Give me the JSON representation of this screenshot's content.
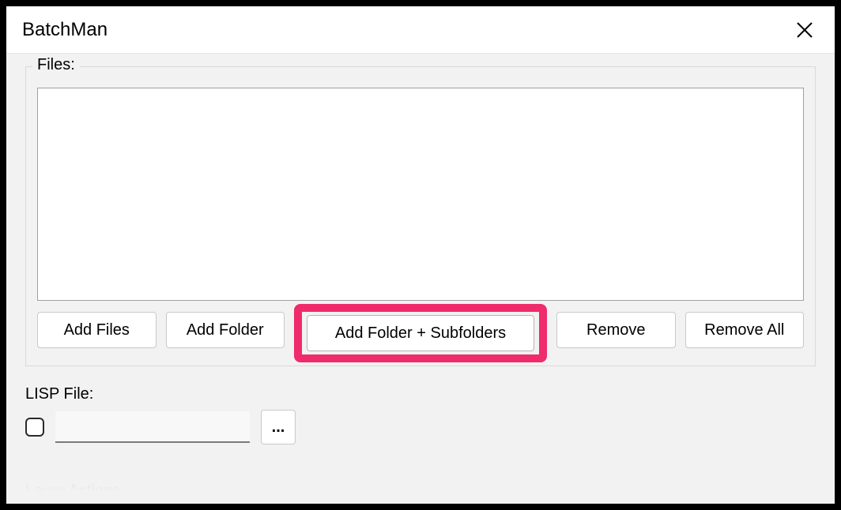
{
  "window": {
    "title": "BatchMan"
  },
  "files": {
    "legend": "Files:",
    "buttons": {
      "add_files": "Add Files",
      "add_folder": "Add Folder",
      "add_folder_sub": "Add Folder + Subfolders",
      "remove": "Remove",
      "remove_all": "Remove All"
    }
  },
  "lisp": {
    "label": "LISP File:",
    "checked": false,
    "path": "",
    "browse": "..."
  },
  "layer_actions": {
    "legend": "Layer Actions:"
  },
  "highlight": {
    "color": "#ef2b6b",
    "target": "add_folder_sub"
  }
}
